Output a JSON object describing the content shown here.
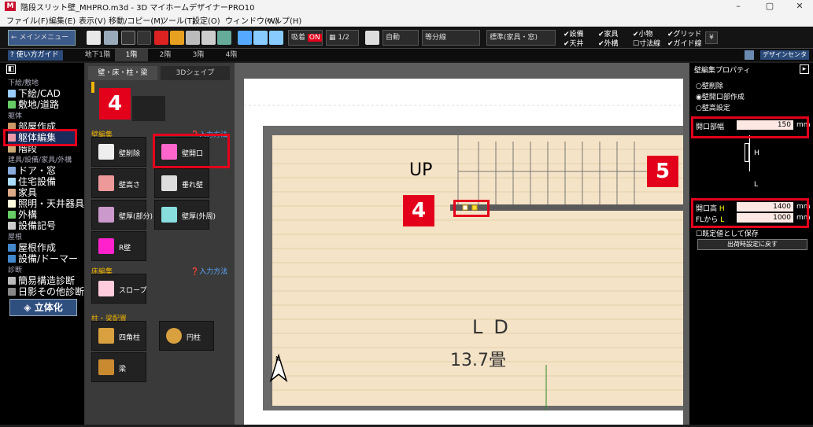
{
  "window": {
    "title": "階段スリット壁_MHPRO.m3d - 3D マイホームデザイナーPRO10",
    "app_icon": "M",
    "minimize": "–",
    "maximize": "▢",
    "close": "✕"
  },
  "menu": [
    "ファイル(F)",
    "編集(E)",
    "表示(V)",
    "移動/コピー(M)",
    "ツール(T)",
    "設定(O)",
    "ウィンドウ(W)",
    "ヘルプ(H)"
  ],
  "toolbar": {
    "main_menu": "← メインメニュー",
    "snap_label": "吸着",
    "snap_state": "ON",
    "grid_scale": "1/2",
    "auto_label": "自動",
    "division_label": "等分線",
    "standard_label": "標準(家具・窓)",
    "toggles": [
      {
        "label": "設備",
        "checked": true
      },
      {
        "label": "天井",
        "checked": true
      },
      {
        "label": "家具",
        "checked": true
      },
      {
        "label": "外構",
        "checked": true
      },
      {
        "label": "小物",
        "checked": true
      },
      {
        "label": "寸法線",
        "checked": false
      },
      {
        "label": "グリッド",
        "checked": true
      },
      {
        "label": "ガイド線",
        "checked": true
      }
    ]
  },
  "guide": "? 使い方ガイド",
  "floor_tabs": [
    "地下1階",
    "1階",
    "2階",
    "3階",
    "4階"
  ],
  "active_floor": 1,
  "view_toggle": "デザインセンター",
  "nav": {
    "sections": [
      {
        "label": "下絵/敷地",
        "items": [
          {
            "label": "下絵/CAD",
            "icon": "cad-icon"
          },
          {
            "label": "敷地/道路",
            "icon": "site-icon"
          }
        ]
      },
      {
        "label": "躯体",
        "items": [
          {
            "label": "部屋作成",
            "icon": "room-icon"
          },
          {
            "label": "躯体編集",
            "icon": "frame-edit-icon"
          },
          {
            "label": "階段",
            "icon": "stairs-icon"
          }
        ]
      },
      {
        "label": "建具/設備/家具/外構",
        "items": [
          {
            "label": "ドア・窓",
            "icon": "door-icon"
          },
          {
            "label": "住宅設備",
            "icon": "equipment-icon"
          },
          {
            "label": "家具",
            "icon": "furniture-icon"
          },
          {
            "label": "照明・天井器具",
            "icon": "light-icon"
          },
          {
            "label": "外構",
            "icon": "exterior-icon"
          },
          {
            "label": "設備記号",
            "icon": "symbol-icon"
          }
        ]
      },
      {
        "label": "屋根",
        "items": [
          {
            "label": "屋根作成",
            "icon": "roof-icon"
          },
          {
            "label": "設備/ドーマー",
            "icon": "dormer-icon"
          }
        ]
      },
      {
        "label": "診断",
        "items": [
          {
            "label": "簡易構造診断",
            "icon": "structure-icon"
          },
          {
            "label": "日影その他診断",
            "icon": "shadow-icon"
          }
        ]
      }
    ],
    "render_button": "立体化"
  },
  "panel": {
    "tabs": [
      "壁・床・柱・梁",
      "3Dシェイプ"
    ],
    "wall_section": "壁編集",
    "floor_section": "床編集",
    "column_section": "柱・梁配置",
    "howto": "入力方法",
    "wall_tools": [
      "壁削除",
      "壁開口",
      "壁高さ",
      "垂れ壁",
      "壁厚(部分)",
      "壁厚(外周)",
      "R壁"
    ],
    "floor_tools": [
      "スロープ"
    ],
    "column_tools": [
      "四角柱",
      "円柱",
      "梁"
    ]
  },
  "canvas": {
    "up_label": "UP",
    "room_name": "LD",
    "room_size": "13.7畳",
    "north": "N"
  },
  "props": {
    "title": "壁編集プロパティ",
    "options": [
      {
        "label": "壁削除",
        "selected": false
      },
      {
        "label": "壁開口部作成",
        "selected": true
      },
      {
        "label": "壁高設定",
        "selected": false
      }
    ],
    "opening_width_label": "開口部幅",
    "opening_width": "150",
    "opening_height_label": "開口高",
    "opening_height_key": "H",
    "opening_height": "1400",
    "fl_label": "FLから",
    "fl_key": "L",
    "fl_value": "1000",
    "unit": "mm",
    "diagram_h": "H",
    "diagram_l": "L",
    "keep_label": "既定値として保存",
    "restore_button": "出荷時設定に戻す"
  },
  "callouts": [
    "4",
    "4",
    "5"
  ],
  "colors": {
    "accent_red": "#e3001b",
    "floor_tan": "#f4e3c6",
    "wall_gray": "#5a5a5a"
  }
}
